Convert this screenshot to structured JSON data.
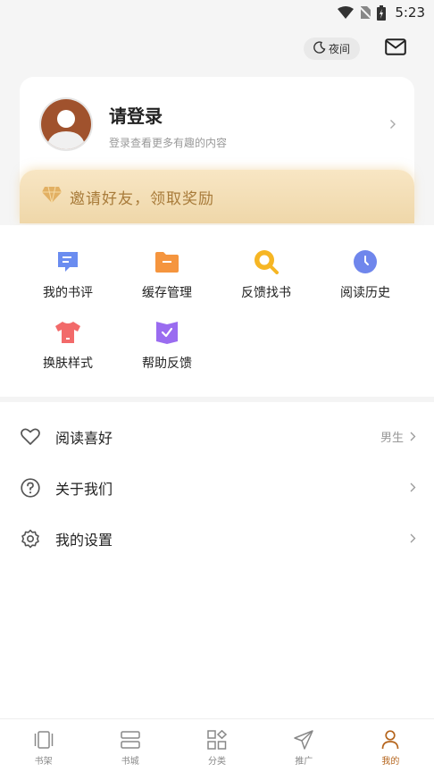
{
  "status_bar": {
    "time": "5:23"
  },
  "header": {
    "night_mode_label": "夜间"
  },
  "profile": {
    "title": "请登录",
    "subtitle": "登录查看更多有趣的内容"
  },
  "invite": {
    "label": "邀请好友，领取奖励"
  },
  "grid": {
    "items": [
      {
        "label": "我的书评",
        "icon": "comment-icon"
      },
      {
        "label": "缓存管理",
        "icon": "folder-icon"
      },
      {
        "label": "反馈找书",
        "icon": "search-book-icon"
      },
      {
        "label": "阅读历史",
        "icon": "clock-icon"
      },
      {
        "label": "换肤样式",
        "icon": "shirt-icon"
      },
      {
        "label": "帮助反馈",
        "icon": "help-check-icon"
      }
    ]
  },
  "list": {
    "items": [
      {
        "label": "阅读喜好",
        "value": "男生",
        "icon": "heart-icon"
      },
      {
        "label": "关于我们",
        "value": "",
        "icon": "question-icon"
      },
      {
        "label": "我的设置",
        "value": "",
        "icon": "gear-icon"
      }
    ]
  },
  "tabs": [
    {
      "label": "书架",
      "icon": "bookshelf-icon"
    },
    {
      "label": "书城",
      "icon": "bookstore-icon"
    },
    {
      "label": "分类",
      "icon": "category-icon"
    },
    {
      "label": "推广",
      "icon": "send-icon"
    },
    {
      "label": "我的",
      "icon": "person-icon",
      "active": true
    }
  ],
  "colors": {
    "accent": "#b5651d",
    "invite_text": "#a87b3a",
    "invite_bg": "#f3ddb3"
  }
}
